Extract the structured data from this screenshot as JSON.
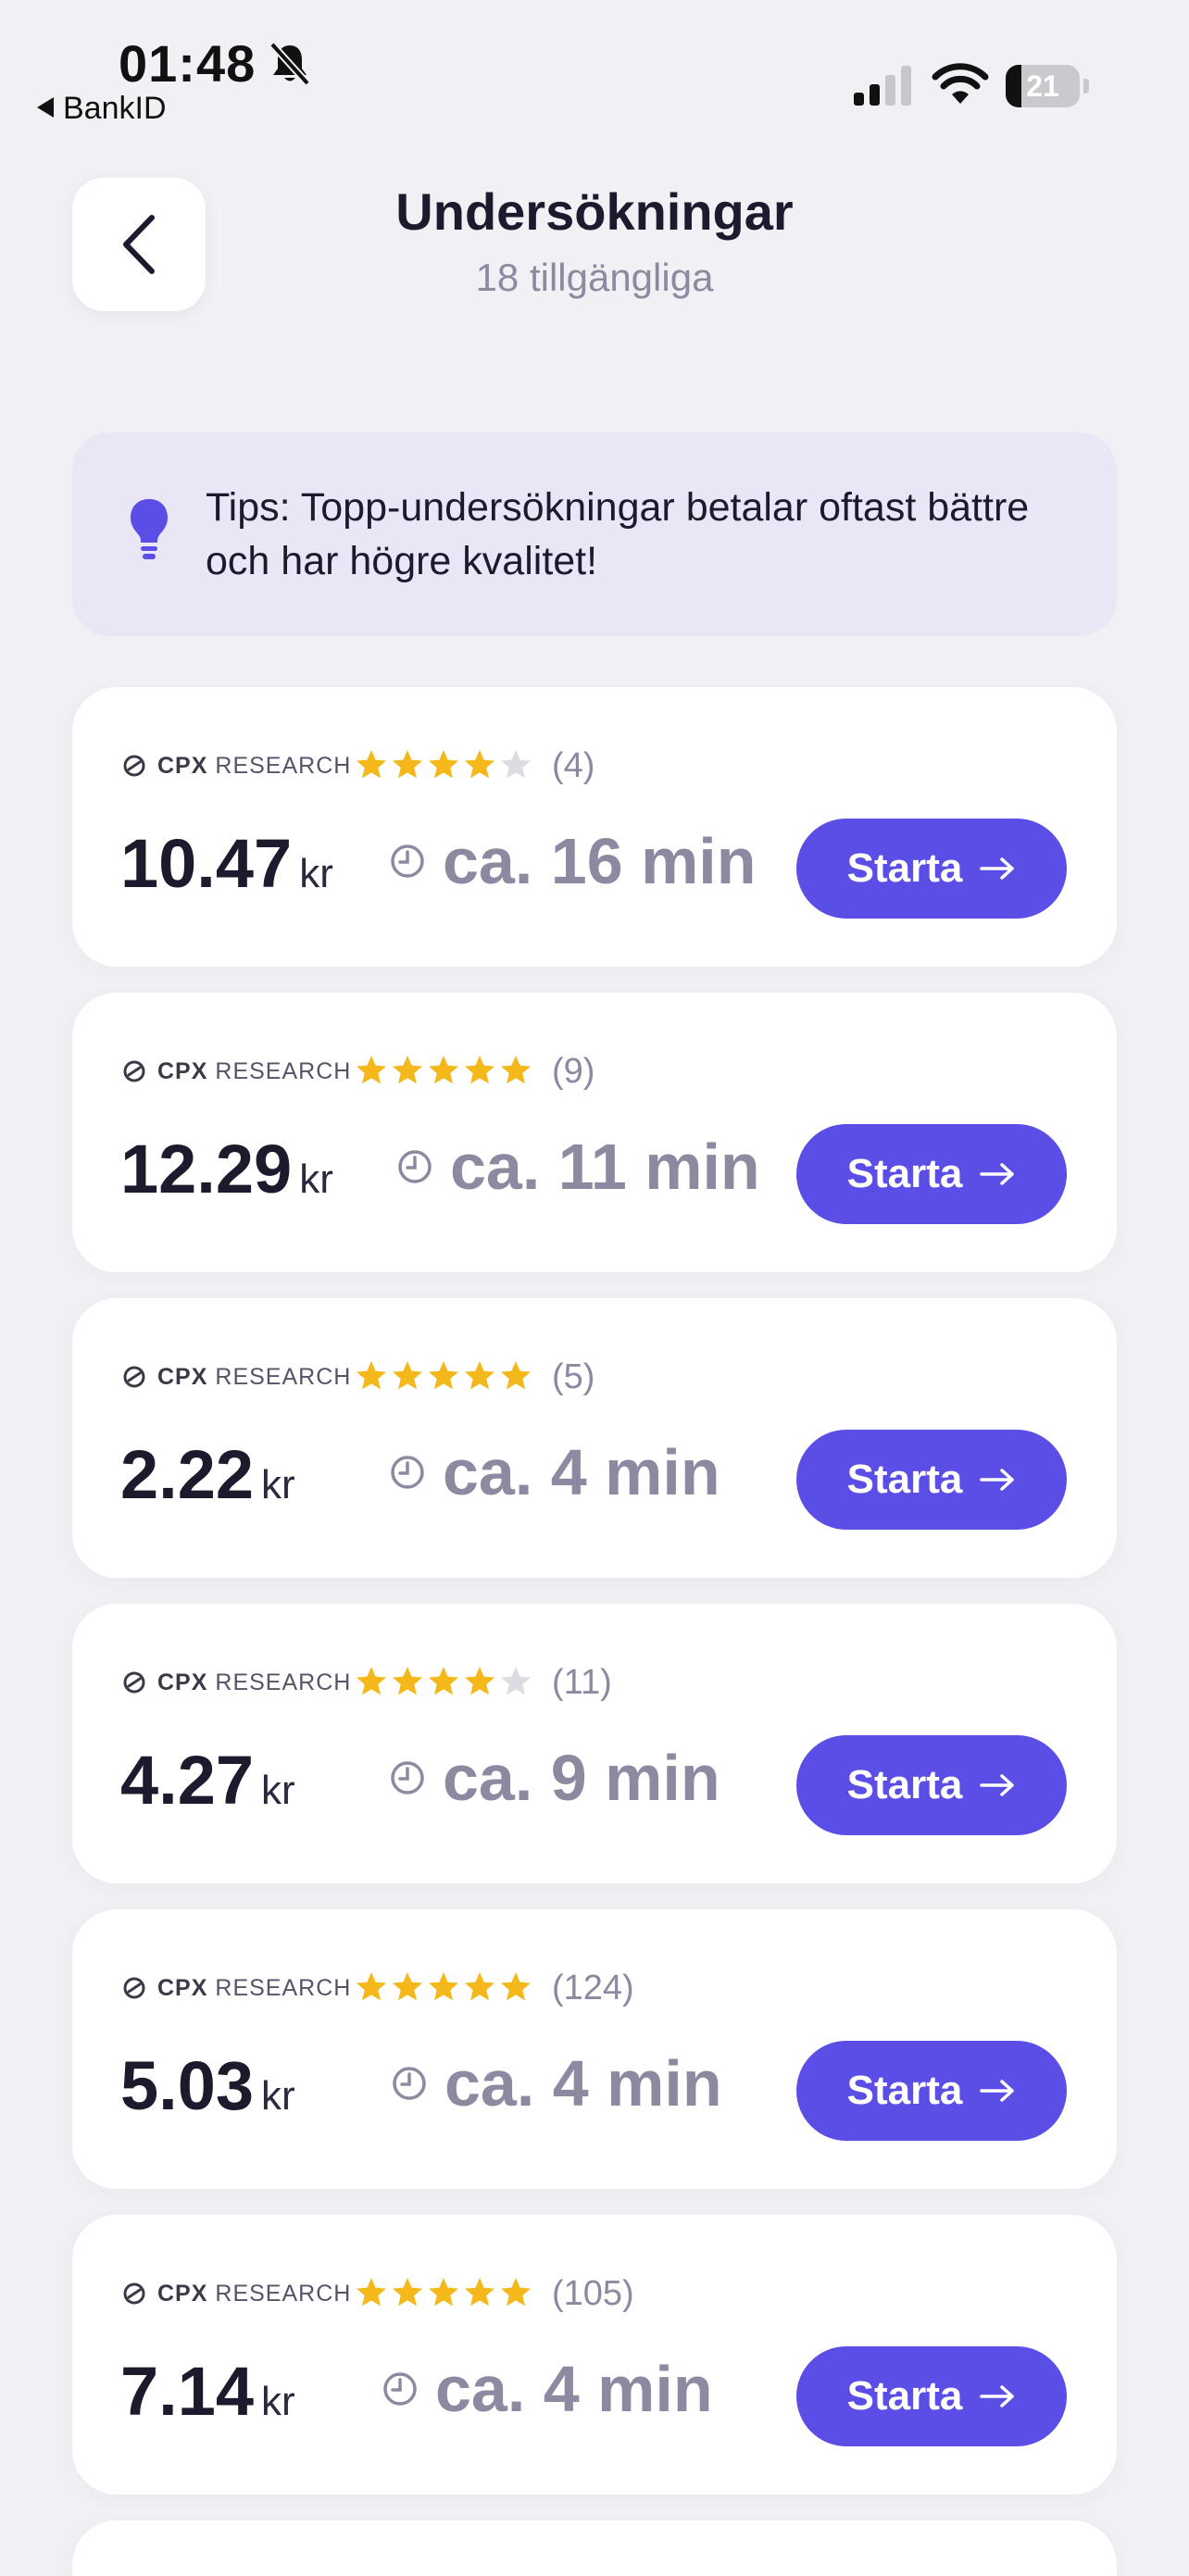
{
  "status_bar": {
    "time": "01:48",
    "back_app": "BankID",
    "battery_level": "21",
    "battery_fraction": 0.21
  },
  "header": {
    "title": "Undersökningar",
    "subtitle": "18 tillgängliga"
  },
  "tip": {
    "text": "Tips: Topp-undersökningar betalar oftast bättre och har högre kvalitet!"
  },
  "colors": {
    "accent": "#5b4ee6",
    "star": "#f5b81a",
    "star_empty": "#dcdce2",
    "muted": "#8b8aa0"
  },
  "surveys": [
    {
      "provider_strong": "CPX",
      "provider_rest": "RESEARCH",
      "rating": 4,
      "reviews": "(4)",
      "price": "10.47",
      "currency": "kr",
      "duration": "ca. 16 min",
      "button": "Starta"
    },
    {
      "provider_strong": "CPX",
      "provider_rest": "RESEARCH",
      "rating": 5,
      "reviews": "(9)",
      "price": "12.29",
      "currency": "kr",
      "duration": "ca. 11 min",
      "button": "Starta"
    },
    {
      "provider_strong": "CPX",
      "provider_rest": "RESEARCH",
      "rating": 5,
      "reviews": "(5)",
      "price": "2.22",
      "currency": "kr",
      "duration": "ca. 4 min",
      "button": "Starta"
    },
    {
      "provider_strong": "CPX",
      "provider_rest": "RESEARCH",
      "rating": 4,
      "reviews": "(11)",
      "price": "4.27",
      "currency": "kr",
      "duration": "ca. 9 min",
      "button": "Starta"
    },
    {
      "provider_strong": "CPX",
      "provider_rest": "RESEARCH",
      "rating": 5,
      "reviews": "(124)",
      "price": "5.03",
      "currency": "kr",
      "duration": "ca. 4 min",
      "button": "Starta"
    },
    {
      "provider_strong": "CPX",
      "provider_rest": "RESEARCH",
      "rating": 5,
      "reviews": "(105)",
      "price": "7.14",
      "currency": "kr",
      "duration": "ca. 4 min",
      "button": "Starta"
    }
  ]
}
